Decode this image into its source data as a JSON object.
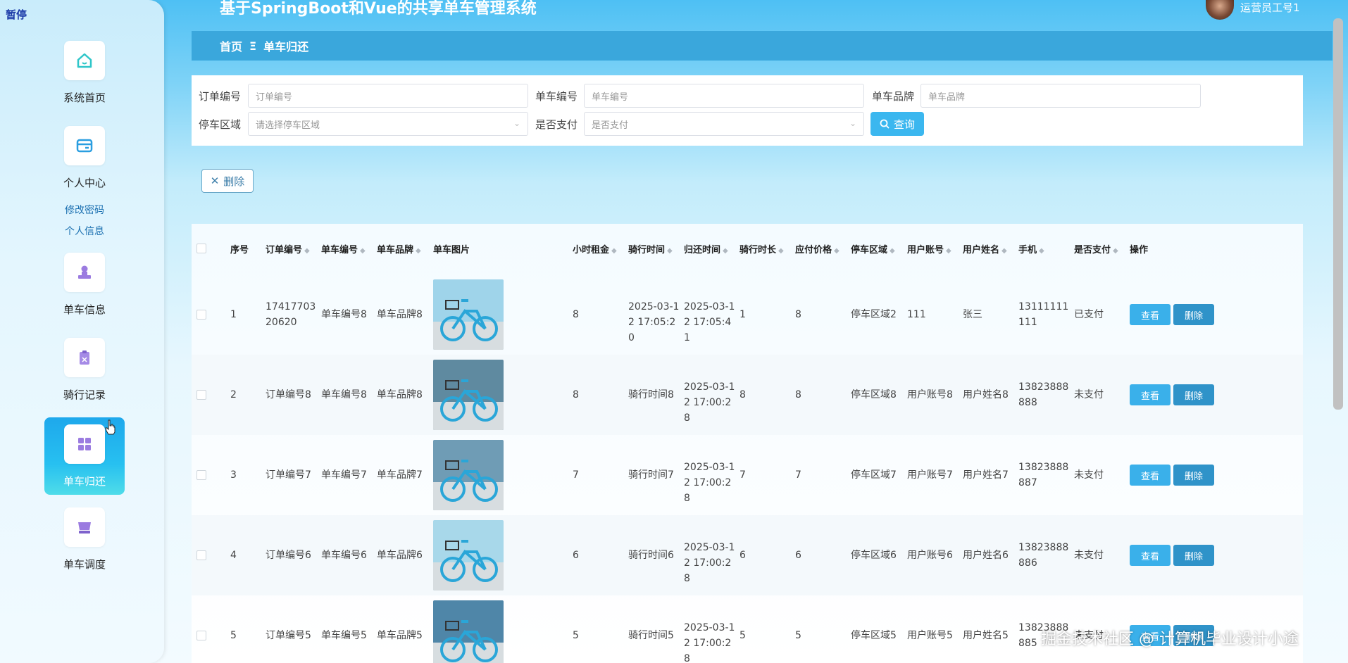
{
  "overlay": {
    "pause_label": "暂停"
  },
  "header": {
    "title": "基于SpringBoot和Vue的共享单车管理系统",
    "user": "运营员工号1"
  },
  "breadcrumb": {
    "home": "首页",
    "separator": "Ξ",
    "current": "单车归还"
  },
  "sidebar": {
    "items": [
      {
        "label": "系统首页",
        "icon": "home-icon"
      },
      {
        "label": "个人中心",
        "icon": "wallet-icon"
      },
      {
        "label": "单车信息",
        "icon": "user-stamp-icon"
      },
      {
        "label": "骑行记录",
        "icon": "clipboard-icon"
      },
      {
        "label": "单车归还",
        "icon": "grid-icon",
        "active": true
      },
      {
        "label": "单车调度",
        "icon": "basket-icon"
      }
    ],
    "submenu": [
      "修改密码",
      "个人信息"
    ]
  },
  "search": {
    "order_label": "订单编号",
    "order_placeholder": "订单编号",
    "bike_label": "单车编号",
    "bike_placeholder": "单车编号",
    "brand_label": "单车品牌",
    "brand_placeholder": "单车品牌",
    "area_label": "停车区域",
    "area_placeholder": "请选择停车区域",
    "paid_label": "是否支付",
    "paid_placeholder": "是否支付",
    "query_button": "查询"
  },
  "toolbar": {
    "delete_button": "删除"
  },
  "table": {
    "headers": [
      "序号",
      "订单编号",
      "单车编号",
      "单车品牌",
      "单车图片",
      "小时租金",
      "骑行时间",
      "归还时间",
      "骑行时长",
      "应付价格",
      "停车区域",
      "用户账号",
      "用户姓名",
      "手机",
      "是否支付",
      "操作"
    ],
    "view_label": "查看",
    "delete_label": "删除",
    "rows": [
      {
        "no": "1",
        "order": "1741770320620",
        "bike": "单车编号8",
        "brand": "单车品牌8",
        "rent": "8",
        "ride_time": "2025-03-12 17:05:20",
        "return_time": "2025-03-12 17:05:41",
        "duration": "1",
        "price": "8",
        "area": "停车区域2",
        "account": "111",
        "name": "张三",
        "phone": "13111111111",
        "paid": "已支付"
      },
      {
        "no": "2",
        "order": "订单编号8",
        "bike": "单车编号8",
        "brand": "单车品牌8",
        "rent": "8",
        "ride_time": "骑行时间8",
        "return_time": "2025-03-12 17:00:28",
        "duration": "8",
        "price": "8",
        "area": "停车区域8",
        "account": "用户账号8",
        "name": "用户姓名8",
        "phone": "13823888888",
        "paid": "未支付"
      },
      {
        "no": "3",
        "order": "订单编号7",
        "bike": "单车编号7",
        "brand": "单车品牌7",
        "rent": "7",
        "ride_time": "骑行时间7",
        "return_time": "2025-03-12 17:00:28",
        "duration": "7",
        "price": "7",
        "area": "停车区域7",
        "account": "用户账号7",
        "name": "用户姓名7",
        "phone": "13823888887",
        "paid": "未支付"
      },
      {
        "no": "4",
        "order": "订单编号6",
        "bike": "单车编号6",
        "brand": "单车品牌6",
        "rent": "6",
        "ride_time": "骑行时间6",
        "return_time": "2025-03-12 17:00:28",
        "duration": "6",
        "price": "6",
        "area": "停车区域6",
        "account": "用户账号6",
        "name": "用户姓名6",
        "phone": "13823888886",
        "paid": "未支付"
      },
      {
        "no": "5",
        "order": "订单编号5",
        "bike": "单车编号5",
        "brand": "单车品牌5",
        "rent": "5",
        "ride_time": "骑行时间5",
        "return_time": "2025-03-12 17:00:28",
        "duration": "5",
        "price": "5",
        "area": "停车区域5",
        "account": "用户账号5",
        "name": "用户姓名5",
        "phone": "13823888885",
        "paid": "未支付"
      }
    ]
  },
  "watermark": "掘金技术社区 @ 计算机毕业设计小途",
  "colors": {
    "accent": "#3ab0ea",
    "breadcrumb": "#3aa7dc",
    "active_menu": "#1ea8ec"
  }
}
